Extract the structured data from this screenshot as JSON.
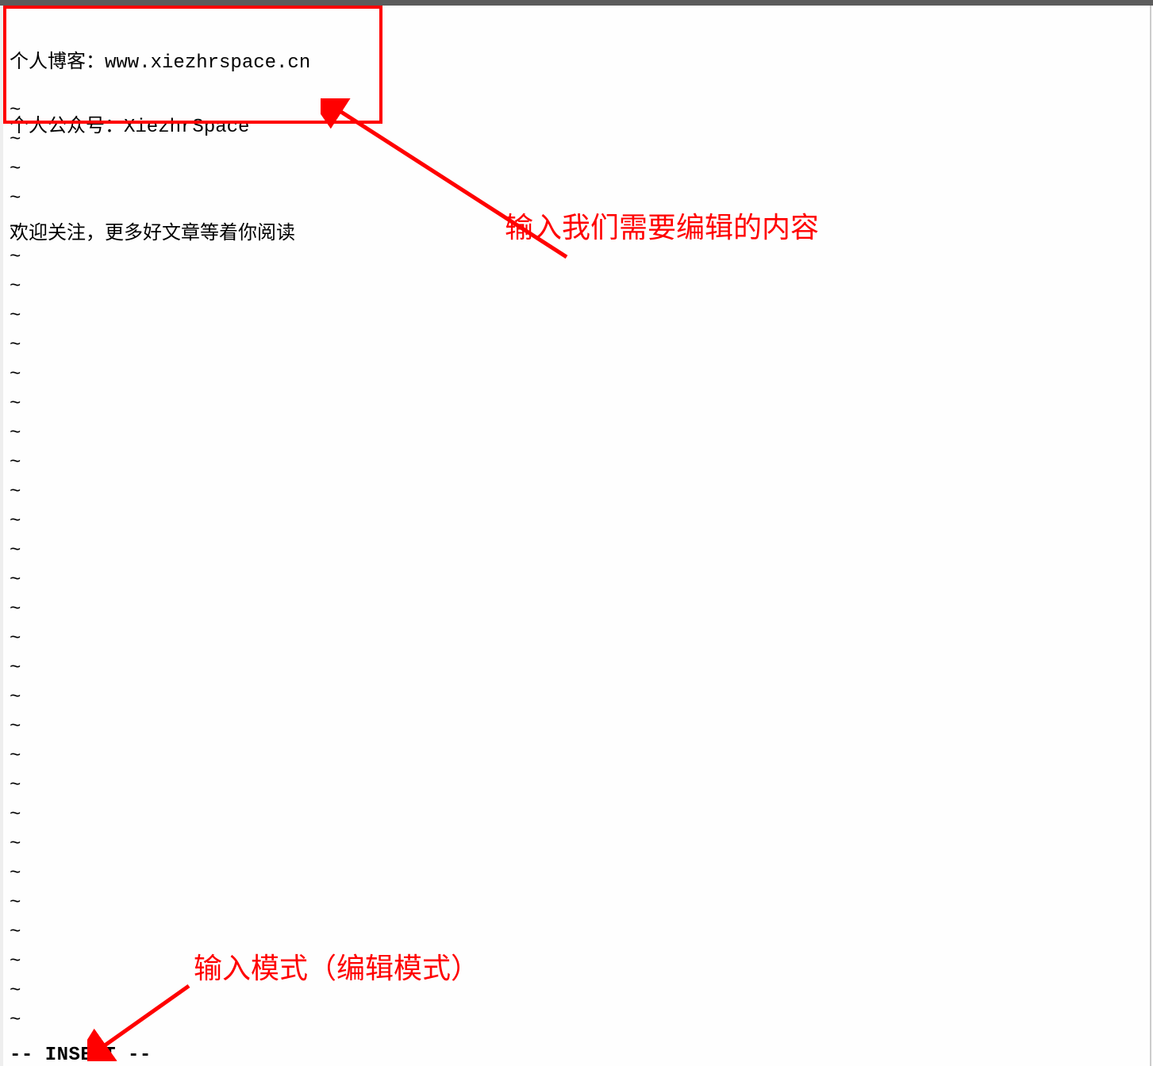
{
  "editor": {
    "lines": [
      "个人博客：www.xiezhrspace.cn",
      "个人公众号：XiezhrSpace",
      "",
      "欢迎关注，更多好文章等着你阅读"
    ],
    "tilde": "~",
    "tilde_count": 32,
    "status": "-- INSERT --"
  },
  "annotations": {
    "content_label": "输入我们需要编辑的内容",
    "mode_label": "输入模式（编辑模式）"
  }
}
